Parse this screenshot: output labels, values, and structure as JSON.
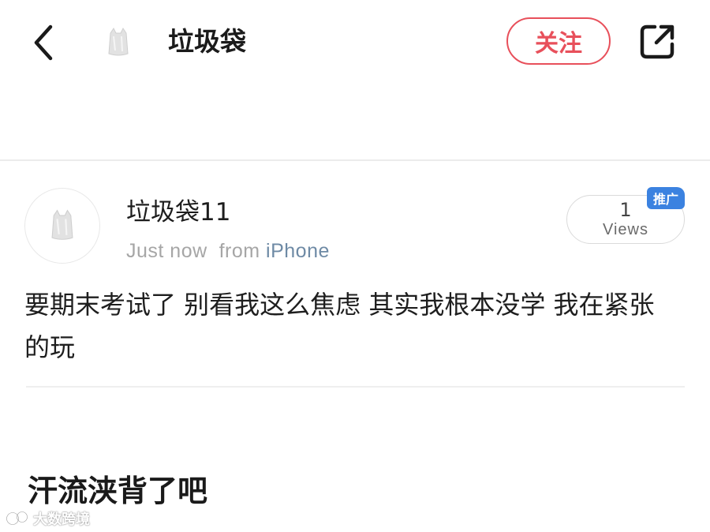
{
  "header": {
    "title": "垃圾袋",
    "follow_label": "关注",
    "icons": {
      "back": "chevron-left-icon",
      "share": "external-link-icon",
      "avatar": "plastic-bag-icon"
    }
  },
  "post": {
    "username": "垃圾袋11",
    "time": "Just now",
    "from_label": "from",
    "source": "iPhone",
    "views_count": "1",
    "views_label": "Views",
    "promo_badge": "推广",
    "text": "要期末考试了 别看我这么焦虑 其实我根本没学 我在紧张的玩"
  },
  "comment": {
    "text": "汗流浃背了吧"
  },
  "watermark": {
    "text": "大数跨境"
  },
  "colors": {
    "accent_red": "#e8505b",
    "link_blue": "#6e8aa5",
    "badge_blue": "#3b82e0",
    "muted_gray": "#a6a6a6"
  }
}
